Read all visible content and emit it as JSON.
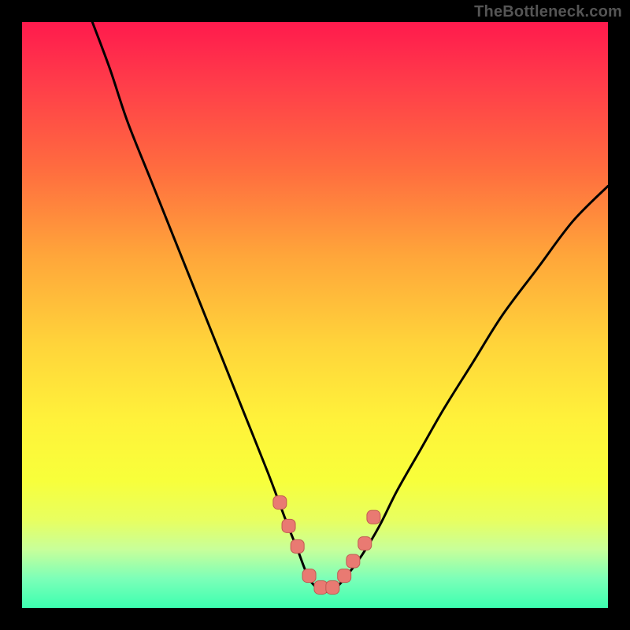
{
  "watermark": "TheBottleneck.com",
  "colors": {
    "frame": "#000000",
    "curve_stroke": "#000000",
    "marker_fill": "#e97a72",
    "marker_stroke": "#c15a52"
  },
  "chart_data": {
    "type": "line",
    "title": "",
    "xlabel": "",
    "ylabel": "",
    "xlim": [
      0,
      100
    ],
    "ylim": [
      0,
      100
    ],
    "grid": false,
    "series": [
      {
        "name": "bottleneck-curve",
        "x": [
          12,
          15,
          18,
          22,
          26,
          30,
          34,
          38,
          42,
          45,
          47,
          49,
          51,
          53,
          55,
          58,
          61,
          64,
          68,
          72,
          77,
          82,
          88,
          94,
          100
        ],
        "values": [
          100,
          92,
          83,
          73,
          63,
          53,
          43,
          33,
          23,
          15,
          10,
          5,
          3,
          3,
          5,
          9,
          14,
          20,
          27,
          34,
          42,
          50,
          58,
          66,
          72
        ]
      }
    ],
    "markers": {
      "name": "highlight-points",
      "x": [
        44.0,
        45.5,
        47.0,
        49.0,
        51.0,
        53.0,
        55.0,
        56.5,
        58.5,
        60.0
      ],
      "values": [
        18.0,
        14.0,
        10.5,
        5.5,
        3.5,
        3.5,
        5.5,
        8.0,
        11.0,
        15.5
      ]
    }
  }
}
